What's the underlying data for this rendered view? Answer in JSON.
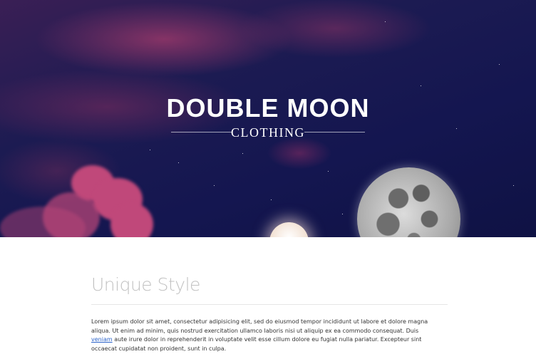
{
  "hero": {
    "brand_title": "DOUBLE MOON",
    "brand_subtitle": "CLOTHING"
  },
  "main": {
    "section_title": "Unique Style",
    "paragraph_before_link": "Lorem ipsum dolor sit amet, consectetur adipisicing elit, sed do eiusmod tempor incididunt ut labore et dolore magna aliqua. Ut enim ad minim, quis nostrud exercitation ullamco laboris nisi ut aliquip ex ea commodo consequat. Duis ",
    "paragraph_link": "veniam",
    "paragraph_after_link": " aute irure dolor in reprehenderit in voluptate velit esse cillum dolore eu fugiat nulla pariatur. Excepteur sint occaecat cupidatat non proident, sunt in culpa."
  },
  "colors": {
    "sky_dark": "#141650",
    "cloud_pink": "#c0487a",
    "link_blue": "#2a62c9",
    "heading_grey": "#c2c2c2"
  }
}
